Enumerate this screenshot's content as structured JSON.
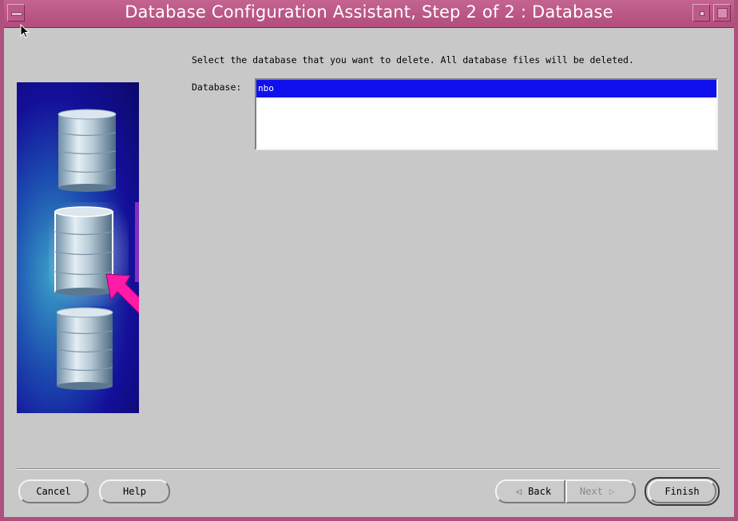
{
  "window": {
    "title": "Database Configuration Assistant, Step 2 of 2 : Database"
  },
  "main": {
    "instruction": "Select the database that you want to delete. All database files will be deleted.",
    "database_label": "Database:",
    "database_list": [
      {
        "name": "nbo",
        "selected": true
      }
    ]
  },
  "buttons": {
    "cancel": "Cancel",
    "help": "Help",
    "back": "Back",
    "next": "Next",
    "finish": "Finish"
  },
  "colors": {
    "titlebar": "#b24d7d",
    "selection": "#1010ee",
    "banner_pointer": "#ff1aa8"
  },
  "icons": {
    "banner": [
      "database-cylinder-icon",
      "database-cylinder-icon",
      "database-cylinder-icon",
      "pointer-arrow-icon"
    ],
    "back": "back-arrow-icon",
    "next": "next-arrow-icon"
  }
}
